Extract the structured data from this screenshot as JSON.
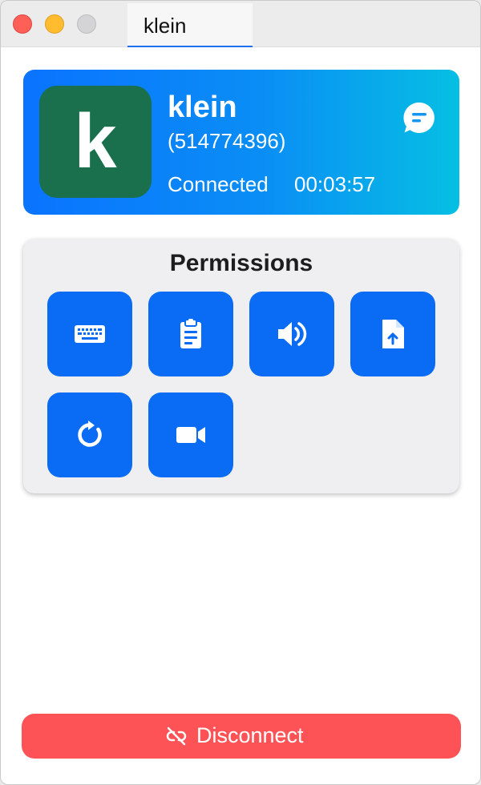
{
  "window": {
    "tab_title": "klein"
  },
  "peer": {
    "avatar_letter": "k",
    "name": "klein",
    "id_display": "(514774396)",
    "status": "Connected",
    "timer": "00:03:57",
    "avatar_color": "#1a6f4c"
  },
  "permissions": {
    "title": "Permissions",
    "buttons": [
      {
        "icon": "keyboard-icon"
      },
      {
        "icon": "clipboard-icon"
      },
      {
        "icon": "speaker-icon"
      },
      {
        "icon": "file-upload-icon"
      },
      {
        "icon": "restart-icon"
      },
      {
        "icon": "video-camera-icon"
      }
    ]
  },
  "footer": {
    "disconnect_label": "Disconnect",
    "disconnect_color": "#fd5356"
  },
  "colors": {
    "accent": "#0a6cf5",
    "card_gradient_start": "#0a73ff",
    "card_gradient_end": "#06bfe3"
  }
}
